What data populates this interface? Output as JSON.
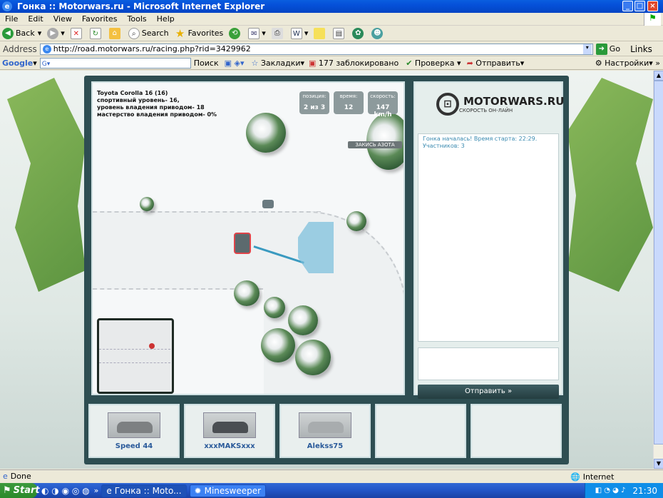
{
  "window": {
    "title": "Гонка :: Motorwars.ru - Microsoft Internet Explorer"
  },
  "menu": [
    "File",
    "Edit",
    "View",
    "Favorites",
    "Tools",
    "Help"
  ],
  "toolbar": {
    "back": "Back",
    "search": "Search",
    "favorites": "Favorites"
  },
  "address": {
    "label": "Address",
    "url": "http://road.motorwars.ru/racing.php?rid=3429962",
    "go": "Go",
    "links": "Links"
  },
  "google": {
    "logo": "Google",
    "search": "Поиск",
    "bookmarks": "Закладки",
    "blocked": "177 заблокировано",
    "check": "Проверка",
    "send": "Отправить",
    "settings": "Настройки"
  },
  "race": {
    "car_info": [
      "Toyota Corolla 16 (16)",
      "спортивный уровень- 16,",
      "уровень владения приводом- 18",
      "мастерство владения приводом- 0%"
    ],
    "stats": [
      {
        "label": "позиция:",
        "value": "2 из 3"
      },
      {
        "label": "время:",
        "value": "12"
      },
      {
        "label": "скорость:",
        "value": "147 km/h"
      }
    ],
    "nitro": "ЗАКИСЬ АЗОТА"
  },
  "side": {
    "logo": "MOTORWARS.RU",
    "tagline": "СКОРОСТЬ ОН-ЛАЙН",
    "chat": [
      "Гонка началась! Время старта: 22:29.",
      "Участников: 3"
    ],
    "send": "Отправить »"
  },
  "players": [
    {
      "name": "Speed 44"
    },
    {
      "name": "xxxMAKSxxx"
    },
    {
      "name": "Alekss75"
    },
    {
      "name": ""
    },
    {
      "name": ""
    }
  ],
  "status": {
    "text": "Done",
    "zone": "Internet"
  },
  "taskbar": {
    "start": "Start",
    "tasks": [
      "Гонка :: Moto...",
      "Minesweeper"
    ],
    "time": "21:30"
  },
  "colors": {
    "title": "#0550d8",
    "game_frame": "#2e4e52"
  }
}
